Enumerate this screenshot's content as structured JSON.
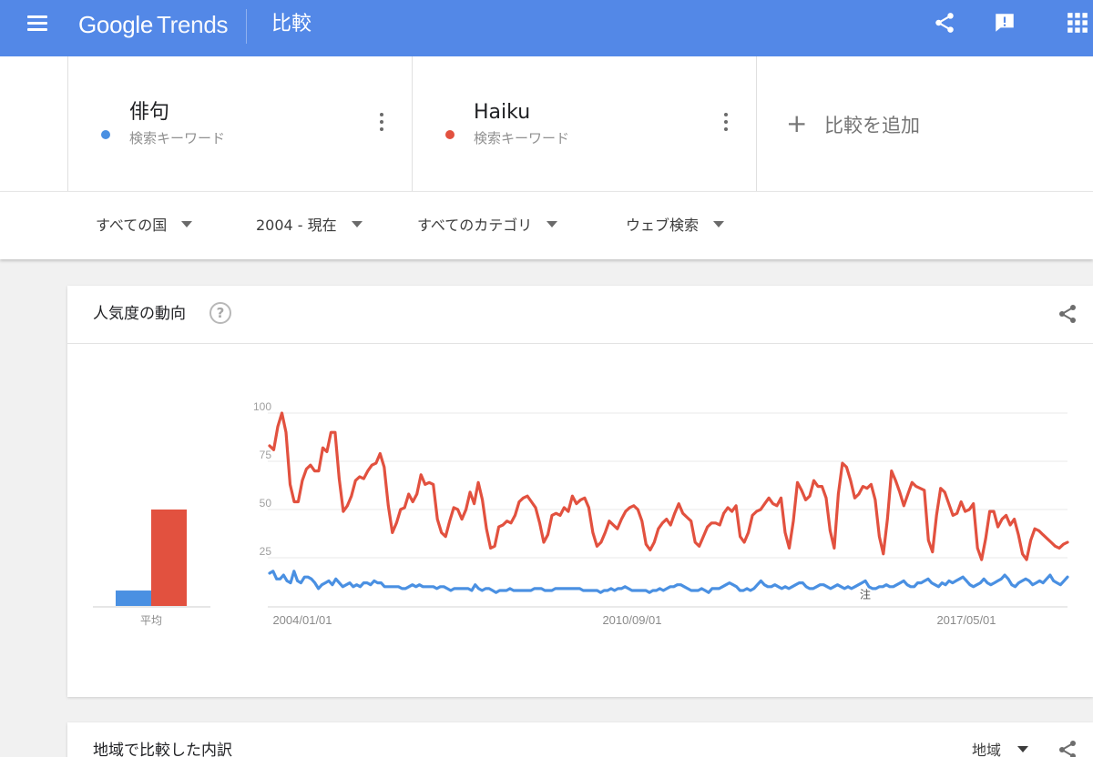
{
  "app": {
    "logo_google": "Google",
    "logo_trends": "Trends",
    "page_title": "比較"
  },
  "colors": {
    "header_bg": "#5388e7",
    "series_1": "#4a90e2",
    "series_2": "#e2513f"
  },
  "icons": [
    "menu-icon",
    "share-icon",
    "feedback-icon",
    "apps-grid-icon",
    "more-vert-icon",
    "add-icon",
    "help-icon",
    "chevron-down-icon"
  ],
  "terms": [
    {
      "name": "俳句",
      "type": "検索キーワード",
      "color": "#4a90e2"
    },
    {
      "name": "Haiku",
      "type": "検索キーワード",
      "color": "#e2513f"
    }
  ],
  "add_compare": {
    "icon": "+",
    "label": "比較を追加"
  },
  "filters": {
    "region": "すべての国",
    "time": "2004 - 現在",
    "category": "すべてのカテゴリ",
    "property": "ウェブ検索"
  },
  "interest_card": {
    "title": "人気度の動向",
    "help": "?"
  },
  "regional_card": {
    "title": "地域で比較した内訳",
    "region_select": "地域"
  },
  "chart_data": {
    "type": "line",
    "y_ticks": [
      25,
      50,
      75,
      100
    ],
    "ylim": [
      0,
      100
    ],
    "x_labels": [
      "2004/01/01",
      "2010/09/01",
      "2017/05/01"
    ],
    "annotation": "注",
    "average": {
      "label": "平均",
      "values": [
        8,
        50
      ]
    },
    "series": [
      {
        "name": "俳句",
        "color": "#4a90e2",
        "values": [
          17,
          18,
          14,
          14,
          16,
          13,
          12,
          18,
          13,
          12,
          15,
          15,
          14,
          12,
          9,
          11,
          12,
          13,
          11,
          14,
          12,
          10,
          11,
          12,
          10,
          11,
          10,
          12,
          12,
          11,
          13,
          12,
          12,
          10,
          10,
          10,
          10,
          10,
          9,
          9,
          10,
          11,
          10,
          11,
          10,
          10,
          10,
          10,
          9,
          10,
          10,
          9,
          8,
          9,
          9,
          9,
          9,
          9,
          8,
          11,
          9,
          8,
          9,
          9,
          8,
          7,
          8,
          8,
          8,
          9,
          8,
          8,
          8,
          8,
          8,
          8,
          9,
          9,
          9,
          8,
          8,
          8,
          9,
          9,
          9,
          9,
          9,
          9,
          9,
          9,
          8,
          8,
          8,
          8,
          8,
          7,
          8,
          8,
          9,
          8,
          9,
          9,
          10,
          9,
          8,
          8,
          8,
          8,
          8,
          7,
          8,
          8,
          9,
          8,
          9,
          10,
          10,
          11,
          11,
          10,
          9,
          8,
          8,
          8,
          9,
          8,
          7,
          9,
          9,
          9,
          10,
          11,
          12,
          11,
          10,
          8,
          8,
          9,
          8,
          9,
          11,
          13,
          11,
          10,
          10,
          11,
          10,
          9,
          10,
          9,
          10,
          11,
          12,
          12,
          10,
          9,
          9,
          10,
          11,
          11,
          10,
          9,
          10,
          11,
          10,
          9,
          10,
          9,
          10,
          11,
          12,
          13,
          10,
          9,
          9,
          10,
          10,
          11,
          10,
          10,
          11,
          12,
          13,
          11,
          10,
          10,
          12,
          12,
          13,
          14,
          12,
          11,
          10,
          12,
          11,
          13,
          12,
          13,
          14,
          15,
          13,
          11,
          10,
          11,
          12,
          14,
          12,
          11,
          12,
          13,
          14,
          16,
          14,
          11,
          10,
          12,
          13,
          14,
          13,
          11,
          12,
          13,
          12,
          14,
          16,
          13,
          12,
          11,
          13,
          15
        ],
        "_note": "approximate monthly values read from chart"
      },
      {
        "name": "Haiku",
        "color": "#e2513f",
        "values": [
          83,
          81,
          93,
          100,
          90,
          63,
          54,
          54,
          65,
          71,
          73,
          70,
          70,
          82,
          80,
          90,
          90,
          66,
          49,
          52,
          57,
          65,
          67,
          66,
          70,
          73,
          74,
          79,
          72,
          52,
          38,
          43,
          50,
          51,
          58,
          54,
          58,
          68,
          63,
          64,
          63,
          45,
          38,
          36,
          44,
          51,
          50,
          45,
          50,
          59,
          53,
          64,
          55,
          40,
          30,
          31,
          41,
          42,
          44,
          43,
          47,
          54,
          56,
          57,
          54,
          51,
          43,
          33,
          37,
          47,
          48,
          47,
          51,
          49,
          57,
          53,
          55,
          56,
          51,
          38,
          31,
          33,
          38,
          44,
          42,
          40,
          45,
          49,
          51,
          52,
          50,
          44,
          32,
          29,
          33,
          40,
          43,
          45,
          42,
          48,
          53,
          48,
          46,
          44,
          33,
          31,
          36,
          41,
          43,
          43,
          42,
          48,
          51,
          49,
          52,
          36,
          33,
          38,
          47,
          49,
          50,
          53,
          56,
          53,
          52,
          56,
          38,
          30,
          44,
          64,
          60,
          55,
          57,
          65,
          62,
          62,
          56,
          39,
          30,
          58,
          74,
          72,
          65,
          56,
          58,
          62,
          61,
          63,
          55,
          36,
          27,
          45,
          70,
          65,
          59,
          52,
          58,
          64,
          62,
          61,
          60,
          34,
          28,
          47,
          61,
          59,
          53,
          47,
          48,
          54,
          49,
          50,
          53,
          30,
          24,
          35,
          49,
          49,
          41,
          45,
          47,
          42,
          45,
          37,
          27,
          24,
          34,
          40,
          39,
          37,
          35,
          33,
          31,
          30,
          32,
          33
        ],
        "_note": "approximate monthly values read from chart"
      }
    ]
  }
}
